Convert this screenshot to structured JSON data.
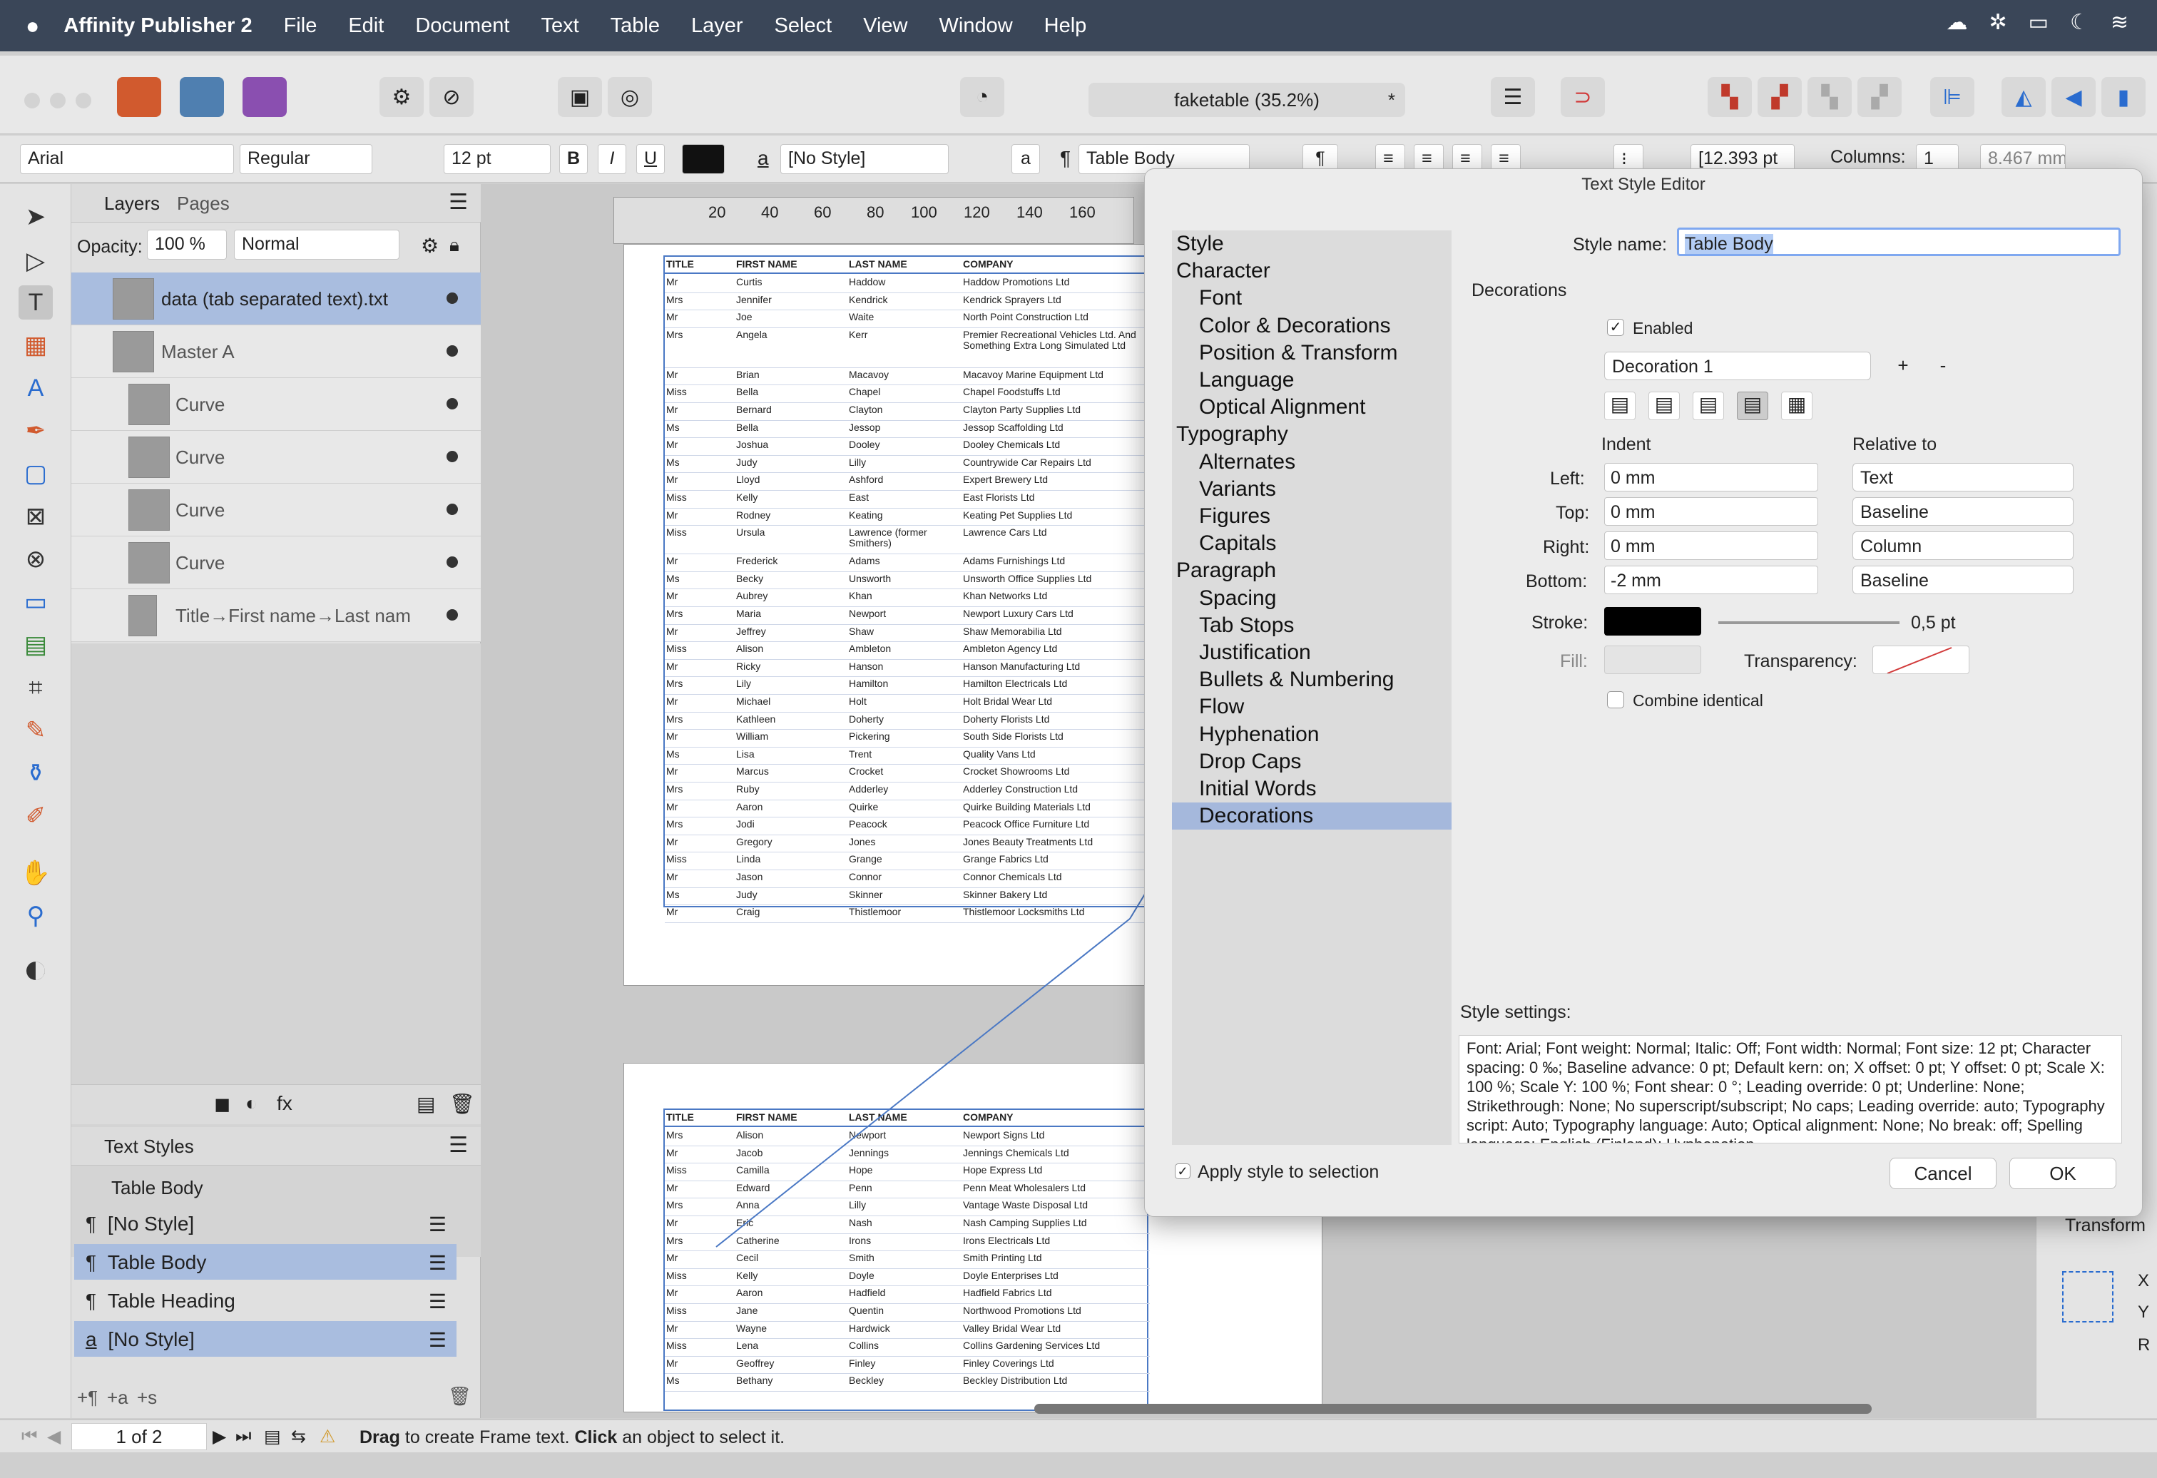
{
  "menubar": {
    "app_name": "Affinity Publisher 2",
    "items": [
      "File",
      "Edit",
      "Document",
      "Text",
      "Table",
      "Layer",
      "Select",
      "View",
      "Window",
      "Help"
    ]
  },
  "toolbar": {
    "document_title": "faketable (35.2%)",
    "modified_mark": "*"
  },
  "context_bar": {
    "font_family": "Arial",
    "font_weight": "Regular",
    "font_size": "12 pt",
    "bold": "B",
    "italic": "I",
    "underline": "U",
    "char_style_glyph": "a",
    "char_style": "[No Style]",
    "small_a": "a",
    "para_glyph": "¶",
    "para_style": "Table Body",
    "para_glyph2": "¶",
    "leading": "[12.393 pt",
    "columns_label": "Columns:",
    "columns_value": "1",
    "gutter": "8.467 mm"
  },
  "layers_panel": {
    "tabs": [
      "Layers",
      "Pages"
    ],
    "opacity_label": "Opacity:",
    "opacity_value": "100 %",
    "blend_mode": "Normal",
    "rows": [
      {
        "name": "data (tab separated text).txt"
      },
      {
        "name": "Master A"
      },
      {
        "name": "Curve"
      },
      {
        "name": "Curve"
      },
      {
        "name": "Curve"
      },
      {
        "name": "Curve"
      },
      {
        "name": "Title→First name→Last nam"
      }
    ]
  },
  "text_styles_panel": {
    "title": "Text Styles",
    "current": "Table Body",
    "rows": [
      {
        "glyph": "¶",
        "name": "[No Style]"
      },
      {
        "glyph": "¶",
        "name": "Table Body"
      },
      {
        "glyph": "¶",
        "name": "Table Heading"
      },
      {
        "glyph": "a",
        "name": "[No Style]"
      }
    ],
    "footer_tools": [
      "+¶",
      "+a",
      "+s"
    ]
  },
  "ruler": {
    "ticks": [
      "20",
      "40",
      "60",
      "80",
      "100",
      "120",
      "140",
      "160"
    ]
  },
  "table_page1": {
    "headers": [
      "TITLE",
      "FIRST NAME",
      "LAST NAME",
      "COMPANY"
    ],
    "rows": [
      [
        "Mr",
        "Curtis",
        "Haddow",
        "Haddow Promotions Ltd"
      ],
      [
        "Mrs",
        "Jennifer",
        "Kendrick",
        "Kendrick Sprayers Ltd"
      ],
      [
        "Mr",
        "Joe",
        "Waite",
        "North Point Construction Ltd"
      ],
      [
        "Mrs",
        "Angela",
        "Kerr",
        "Premier Recreational Vehicles Ltd. And Something Extra Long Simulated Ltd"
      ],
      [
        "Mr",
        "Brian",
        "Macavoy",
        "Macavoy Marine Equipment Ltd"
      ],
      [
        "Miss",
        "Bella",
        "Chapel",
        "Chapel Foodstuffs Ltd"
      ],
      [
        "Mr",
        "Bernard",
        "Clayton",
        "Clayton Party Supplies Ltd"
      ],
      [
        "Ms",
        "Bella",
        "Jessop",
        "Jessop Scaffolding Ltd"
      ],
      [
        "Mr",
        "Joshua",
        "Dooley",
        "Dooley Chemicals Ltd"
      ],
      [
        "Ms",
        "Judy",
        "Lilly",
        "Countrywide Car Repairs Ltd"
      ],
      [
        "Mr",
        "Lloyd",
        "Ashford",
        "Expert Brewery Ltd"
      ],
      [
        "Miss",
        "Kelly",
        "East",
        "East Florists Ltd"
      ],
      [
        "Mr",
        "Rodney",
        "Keating",
        "Keating Pet Supplies Ltd"
      ],
      [
        "Miss",
        "Ursula",
        "Lawrence (former Smithers)",
        "Lawrence Cars Ltd"
      ],
      [
        "Mr",
        "Frederick",
        "Adams",
        "Adams Furnishings Ltd"
      ],
      [
        "Ms",
        "Becky",
        "Unsworth",
        "Unsworth Office Supplies Ltd"
      ],
      [
        "Mr",
        "Aubrey",
        "Khan",
        "Khan Networks Ltd"
      ],
      [
        "Mrs",
        "Maria",
        "Newport",
        "Newport Luxury Cars Ltd"
      ],
      [
        "Mr",
        "Jeffrey",
        "Shaw",
        "Shaw Memorabilia Ltd"
      ],
      [
        "Miss",
        "Alison",
        "Ambleton",
        "Ambleton Agency Ltd"
      ],
      [
        "Mr",
        "Ricky",
        "Hanson",
        "Hanson Manufacturing Ltd"
      ],
      [
        "Mrs",
        "Lily",
        "Hamilton",
        "Hamilton Electricals Ltd"
      ],
      [
        "Mr",
        "Michael",
        "Holt",
        "Holt Bridal Wear Ltd"
      ],
      [
        "Mrs",
        "Kathleen",
        "Doherty",
        "Doherty Florists Ltd"
      ],
      [
        "Mr",
        "William",
        "Pickering",
        "South Side Florists Ltd"
      ],
      [
        "Ms",
        "Lisa",
        "Trent",
        "Quality Vans Ltd"
      ],
      [
        "Mr",
        "Marcus",
        "Crocket",
        "Crocket Showrooms Ltd"
      ],
      [
        "Mrs",
        "Ruby",
        "Adderley",
        "Adderley Construction Ltd"
      ],
      [
        "Mr",
        "Aaron",
        "Quirke",
        "Quirke Building Materials Ltd"
      ],
      [
        "Mrs",
        "Jodi",
        "Peacock",
        "Peacock Office Furniture Ltd"
      ],
      [
        "Mr",
        "Gregory",
        "Jones",
        "Jones Beauty Treatments Ltd"
      ],
      [
        "Miss",
        "Linda",
        "Grange",
        "Grange Fabrics Ltd"
      ],
      [
        "Mr",
        "Jason",
        "Connor",
        "Connor Chemicals Ltd"
      ],
      [
        "Ms",
        "Judy",
        "Skinner",
        "Skinner Bakery Ltd"
      ],
      [
        "Mr",
        "Craig",
        "Thistlemoor",
        "Thistlemoor Locksmiths Ltd"
      ]
    ]
  },
  "table_page2": {
    "headers": [
      "TITLE",
      "FIRST NAME",
      "LAST NAME",
      "COMPANY"
    ],
    "rows": [
      [
        "Mrs",
        "Alison",
        "Newport",
        "Newport Signs Ltd"
      ],
      [
        "Mr",
        "Jacob",
        "Jennings",
        "Jennings Chemicals Ltd"
      ],
      [
        "Miss",
        "Camilla",
        "Hope",
        "Hope Express Ltd"
      ],
      [
        "Mr",
        "Edward",
        "Penn",
        "Penn Meat Wholesalers Ltd"
      ],
      [
        "Mrs",
        "Anna",
        "Lilly",
        "Vantage Waste Disposal Ltd"
      ],
      [
        "Mr",
        "Eric",
        "Nash",
        "Nash Camping Supplies Ltd"
      ],
      [
        "Mrs",
        "Catherine",
        "Irons",
        "Irons Electricals Ltd"
      ],
      [
        "Mr",
        "Cecil",
        "Smith",
        "Smith Printing Ltd"
      ],
      [
        "Miss",
        "Kelly",
        "Doyle",
        "Doyle Enterprises Ltd"
      ],
      [
        "Mr",
        "Aaron",
        "Hadfield",
        "Hadfield Fabrics Ltd"
      ],
      [
        "Miss",
        "Jane",
        "Quentin",
        "Northwood Promotions Ltd"
      ],
      [
        "Mr",
        "Wayne",
        "Hardwick",
        "Valley Bridal Wear Ltd"
      ],
      [
        "Miss",
        "Lena",
        "Collins",
        "Collins Gardening Services Ltd"
      ],
      [
        "Mr",
        "Geoffrey",
        "Finley",
        "Finley Coverings Ltd"
      ],
      [
        "Ms",
        "Bethany",
        "Beckley",
        "Beckley Distribution Ltd"
      ]
    ]
  },
  "dialog": {
    "title": "Text Style Editor",
    "nav": [
      {
        "label": "Style",
        "sub": false
      },
      {
        "label": "Character",
        "sub": false
      },
      {
        "label": "Font",
        "sub": true
      },
      {
        "label": "Color & Decorations",
        "sub": true
      },
      {
        "label": "Position & Transform",
        "sub": true
      },
      {
        "label": "Language",
        "sub": true
      },
      {
        "label": "Optical Alignment",
        "sub": true
      },
      {
        "label": "Typography",
        "sub": false
      },
      {
        "label": "Alternates",
        "sub": true
      },
      {
        "label": "Variants",
        "sub": true
      },
      {
        "label": "Figures",
        "sub": true
      },
      {
        "label": "Capitals",
        "sub": true
      },
      {
        "label": "Paragraph",
        "sub": false
      },
      {
        "label": "Spacing",
        "sub": true
      },
      {
        "label": "Tab Stops",
        "sub": true
      },
      {
        "label": "Justification",
        "sub": true
      },
      {
        "label": "Bullets & Numbering",
        "sub": true
      },
      {
        "label": "Flow",
        "sub": true
      },
      {
        "label": "Hyphenation",
        "sub": true
      },
      {
        "label": "Drop Caps",
        "sub": true
      },
      {
        "label": "Initial Words",
        "sub": true
      },
      {
        "label": "Decorations",
        "sub": true
      }
    ],
    "style_name_label": "Style name:",
    "style_name_value": "Table Body",
    "decorations_heading": "Decorations",
    "enabled_label": "Enabled",
    "check_mark": "✓",
    "decoration_select": "Decoration 1",
    "add_label": "+",
    "remove_label": "-",
    "indent_heading": "Indent",
    "relative_heading": "Relative to",
    "left_label": "Left:",
    "left_value": "0 mm",
    "left_rel": "Text",
    "top_label": "Top:",
    "top_value": "0 mm",
    "top_rel": "Baseline",
    "right_label": "Right:",
    "right_value": "0 mm",
    "right_rel": "Column",
    "bottom_label": "Bottom:",
    "bottom_value": "-2 mm",
    "bottom_rel": "Baseline",
    "stroke_label": "Stroke:",
    "stroke_width": "0,5 pt",
    "fill_label": "Fill:",
    "transparency_label": "Transparency:",
    "combine_label": "Combine identical",
    "style_settings_label": "Style settings:",
    "style_settings_text": "Font: Arial; Font weight: Normal; Italic: Off; Font width: Normal; Font size: 12 pt; Character spacing: 0 ‰; Baseline advance: 0 pt; Default kern: on; X offset: 0 pt; Y offset: 0 pt; Scale X: 100 %; Scale Y: 100 %; Font shear: 0 °; Leading override: 0 pt; Underline: None; Strikethrough: None; No superscript/subscript; No caps; Leading override: auto; Typography script: Auto; Typography language: Auto; Optical alignment: None; No break: off; Spelling language: English (Finland); Hyphenation",
    "apply_label": "Apply style to selection",
    "cancel_label": "Cancel",
    "ok_label": "OK",
    "colors": {
      "stroke": "#000000",
      "selection": "#a5b8dc",
      "accent": "#3478f6"
    }
  },
  "right_panel": {
    "transform_title": "Transform",
    "x_label": "X",
    "y_label": "Y",
    "r_label": "R"
  },
  "status_bar": {
    "page_indicator": "1 of 2",
    "hint_bold1": "Drag",
    "hint_text1": " to create Frame text. ",
    "hint_bold2": "Click",
    "hint_text2": " an object to select it."
  }
}
